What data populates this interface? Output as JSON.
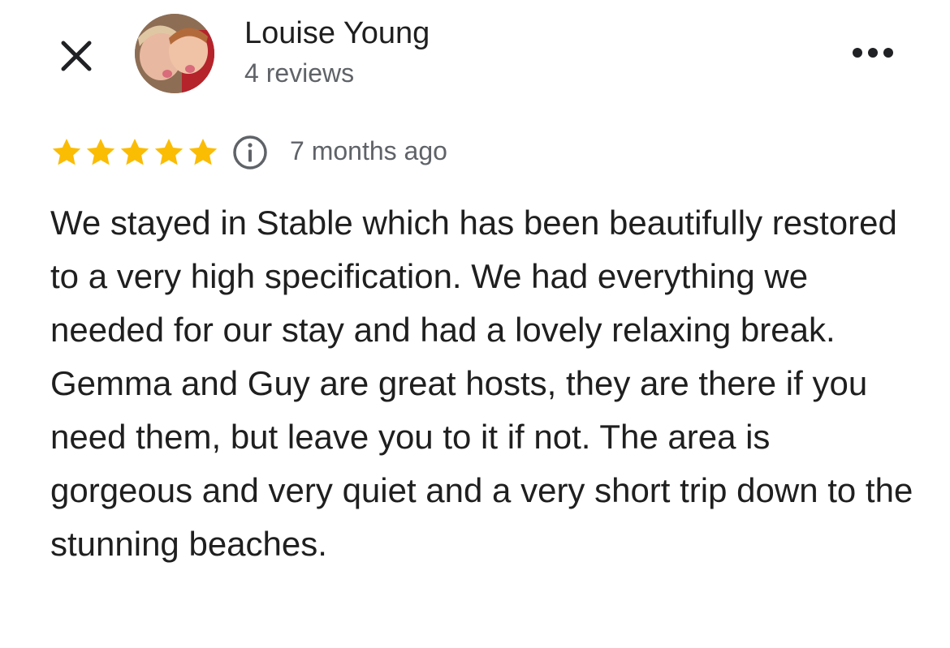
{
  "header": {
    "close_icon": "close-icon",
    "more_icon": "more-options-icon",
    "reviewer": {
      "name": "Louise Young",
      "review_count": "4 reviews",
      "avatar": "avatar-photo"
    }
  },
  "review": {
    "rating": 5,
    "rating_max": 5,
    "star_color": "#fbbc04",
    "info_icon": "info-icon",
    "time_ago": "7 months ago",
    "text": "We stayed in Stable which has been beautifully restored to a very high specification. We had everything we needed for our stay and had a lovely relaxing break. Gemma and Guy are great hosts, they are there if you need them, but leave you to it if not. The area is gorgeous and very quiet and a very short trip down to the stunning beaches."
  }
}
